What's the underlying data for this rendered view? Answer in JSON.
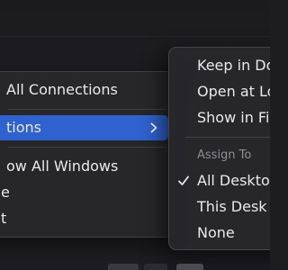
{
  "main_menu": {
    "items": [
      {
        "label": "All Connections"
      },
      {
        "label": "tions",
        "highlighted": true
      },
      {
        "label": "ow All Windows"
      },
      {
        "label": "e"
      },
      {
        "label": "t"
      }
    ]
  },
  "submenu": {
    "items_top": [
      {
        "label": "Keep in Do"
      },
      {
        "label": "Open at Lo"
      },
      {
        "label": "Show in Fi"
      }
    ],
    "assign_header": "Assign To",
    "assign_items": [
      {
        "label": "All Deskto",
        "checked": true
      },
      {
        "label": "This Desk",
        "checked": false
      },
      {
        "label": "None",
        "checked": false
      }
    ]
  },
  "icons": {
    "submenu_arrow": "chevron-right-icon",
    "checkmark": "checkmark-icon"
  },
  "colors": {
    "highlight": "#2f62cf",
    "menu_bg": "#27272a",
    "text": "#e9e9eb",
    "section_header": "#8e8e93"
  }
}
